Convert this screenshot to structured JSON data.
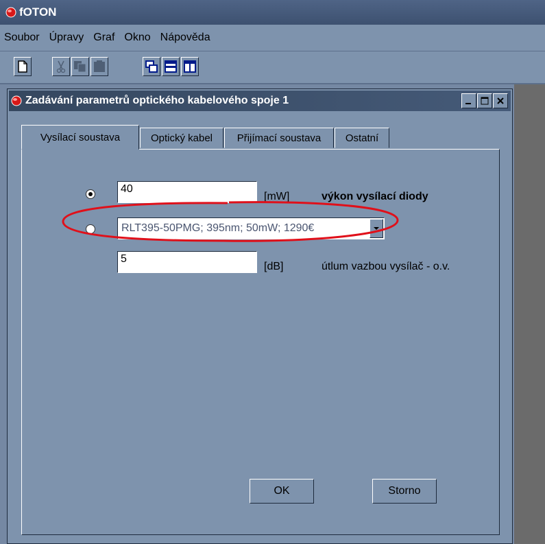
{
  "app": {
    "title": "fOTON"
  },
  "menu": [
    "Soubor",
    "Úpravy",
    "Graf",
    "Okno",
    "Nápověda"
  ],
  "dialog": {
    "title": "Zadávání parametrů optického kabelového spoje 1",
    "tabs": [
      "Vysílací soustava",
      "Optický kabel",
      "Přijímací soustava",
      "Ostatní"
    ],
    "power_value": "40",
    "power_unit": "[mW]",
    "power_label": "výkon vysílací diody",
    "diode_selected": "RLT395-50PMG; 395nm; 50mW; 1290€",
    "coupling_value": "5",
    "coupling_unit": "[dB]",
    "coupling_label": "útlum vazbou vysílač - o.v.",
    "ok_label": "OK",
    "cancel_label": "Storno"
  },
  "colors": {
    "highlight": "#e0101a",
    "logo": "#d81818"
  }
}
